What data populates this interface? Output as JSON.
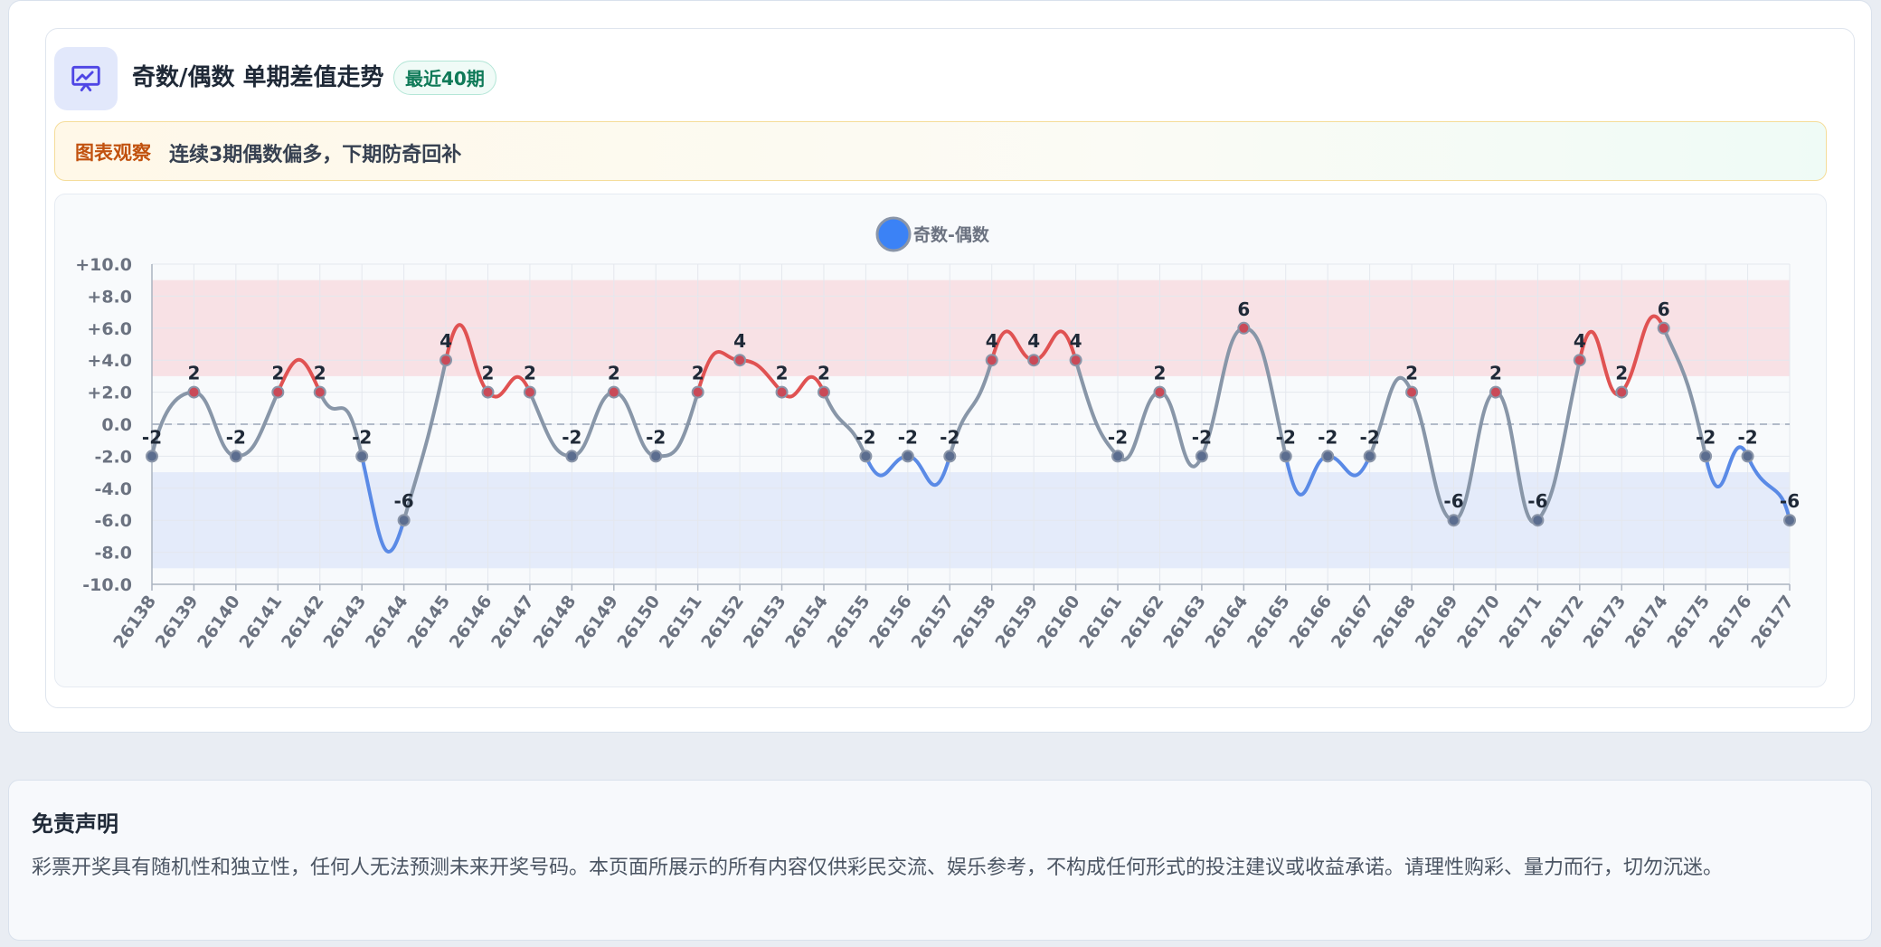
{
  "header": {
    "title": "奇数/偶数 单期差值走势",
    "badge": "最近40期",
    "icon": "presentation-chart-icon"
  },
  "observation": {
    "label": "图表观察",
    "text": "连续3期偶数偏多，下期防奇回补"
  },
  "chart_data": {
    "type": "line",
    "legend": "奇数-偶数",
    "legend_position": "top-center",
    "categories": [
      "26138",
      "26139",
      "26140",
      "26141",
      "26142",
      "26143",
      "26144",
      "26145",
      "26146",
      "26147",
      "26148",
      "26149",
      "26150",
      "26151",
      "26152",
      "26153",
      "26154",
      "26155",
      "26156",
      "26157",
      "26158",
      "26159",
      "26160",
      "26161",
      "26162",
      "26163",
      "26164",
      "26165",
      "26166",
      "26167",
      "26168",
      "26169",
      "26170",
      "26171",
      "26172",
      "26173",
      "26174",
      "26175",
      "26176",
      "26177"
    ],
    "values": [
      -2,
      2,
      -2,
      2,
      2,
      -2,
      -6,
      4,
      2,
      2,
      -2,
      2,
      -2,
      2,
      4,
      2,
      2,
      -2,
      -2,
      -2,
      4,
      4,
      4,
      -2,
      2,
      -2,
      6,
      -2,
      -2,
      -2,
      2,
      -6,
      2,
      -6,
      4,
      2,
      6,
      -2,
      -2,
      -6
    ],
    "ylim": [
      -10,
      10
    ],
    "yticks": [
      "+10.0",
      "+8.0",
      "+6.0",
      "+4.0",
      "+2.0",
      "0.0",
      "-2.0",
      "-4.0",
      "-6.0",
      "-8.0",
      "-10.0"
    ],
    "bands": [
      {
        "from": 3,
        "to": 9,
        "color": "#f8e1e5"
      },
      {
        "from": -9,
        "to": -3,
        "color": "#e4ebfa"
      }
    ],
    "colors": {
      "high": "#e05252",
      "low": "#5a8ae6",
      "neutral": "#8896a8",
      "legend": "#3b82f6"
    },
    "grid": true
  },
  "disclaimer": {
    "title": "免责声明",
    "text": "彩票开奖具有随机性和独立性，任何人无法预测未来开奖号码。本页面所展示的所有内容仅供彩民交流、娱乐参考，不构成任何形式的投注建议或收益承诺。请理性购彩、量力而行，切勿沉迷。"
  }
}
